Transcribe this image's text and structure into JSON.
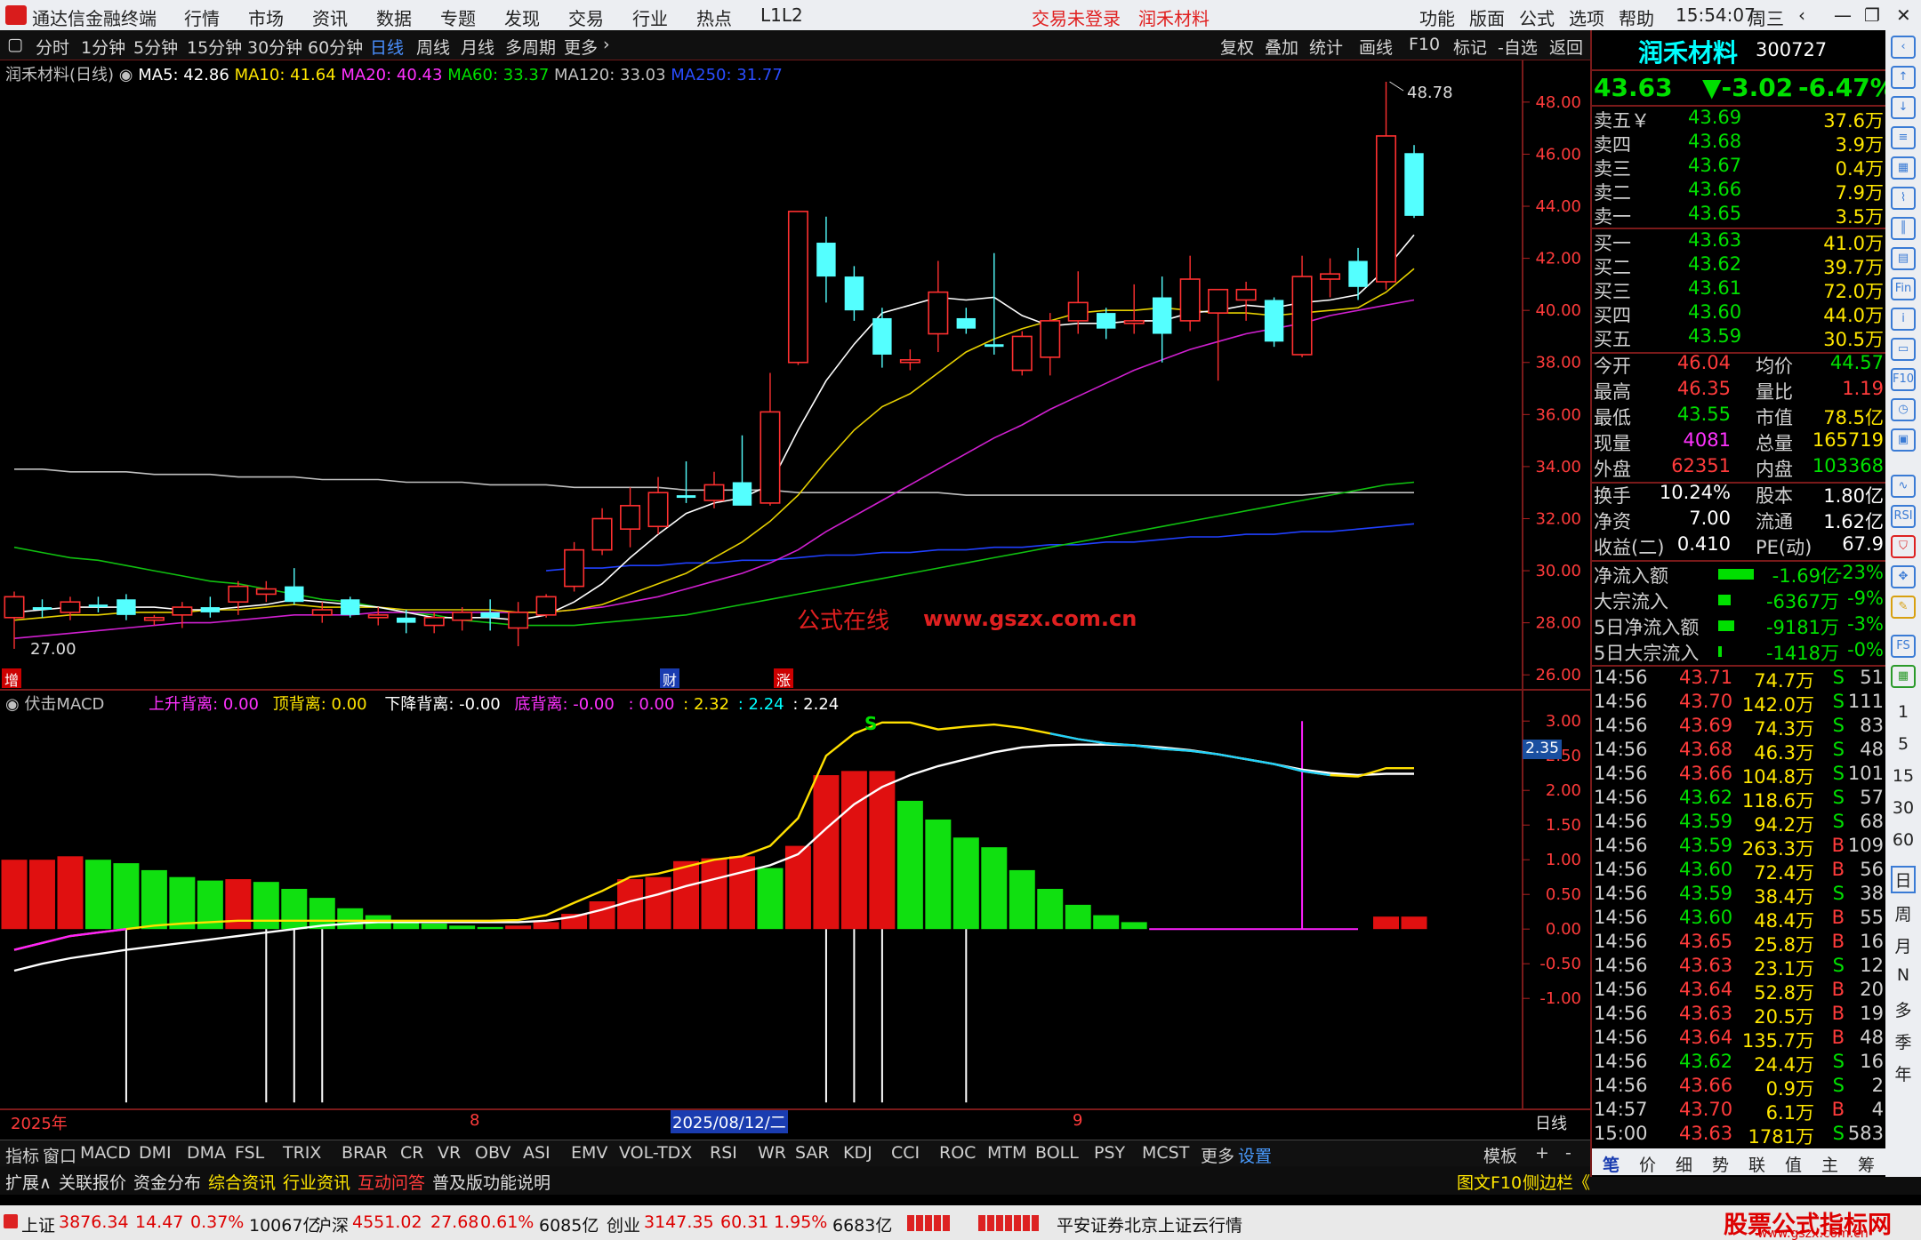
{
  "app": {
    "title": "通达信金融终端"
  },
  "menu": [
    "行情",
    "市场",
    "资讯",
    "数据",
    "专题",
    "发现",
    "交易",
    "行业",
    "热点",
    "L1L2"
  ],
  "notice": {
    "trade": "交易未登录",
    "stock": "润禾材料"
  },
  "window_menu": [
    "功能",
    "版面",
    "公式",
    "选项",
    "帮助"
  ],
  "clock": {
    "time": "15:54:07",
    "weekday": "周三"
  },
  "periods": [
    "分时",
    "1分钟",
    "5分钟",
    "15分钟",
    "30分钟",
    "60分钟",
    "日线",
    "周线",
    "月线",
    "多周期",
    "更多"
  ],
  "active_period": "日线",
  "chart_tools": [
    "复权",
    "叠加",
    "统计",
    "画线",
    "F10",
    "标记",
    "-自选",
    "返回"
  ],
  "ma_line": {
    "name": "润禾材料(日线)",
    "ma5": "MA5: 42.86",
    "ma10": "MA10: 41.64",
    "ma20": "MA20: 40.43",
    "ma60": "MA60: 33.37",
    "ma120": "MA120: 33.03",
    "ma250": "MA250: 31.77"
  },
  "price_axis": [
    "48.00",
    "46.00",
    "44.00",
    "42.00",
    "40.00",
    "38.00",
    "36.00",
    "34.00",
    "32.00",
    "30.00",
    "28.00",
    "26.00"
  ],
  "price_labels": {
    "high": "48.78",
    "low": "27.00"
  },
  "watermark": {
    "cn": "公式在线",
    "url": "www.gszx.com.cn"
  },
  "markers": {
    "zeng": "增",
    "cai": "财",
    "zhang": "涨"
  },
  "macd_header": {
    "name": "伏击MACD",
    "up_div": "上升背离: 0.00",
    "top_div": "顶背离: 0.00",
    "down_div": "下降背离: -0.00",
    "bottom_div": "底背离: -0.00",
    "v1": ": 0.00",
    "v2": ": 2.32",
    "v3": ": 2.24",
    "v4": ": 2.24"
  },
  "macd_axis": [
    "3.00",
    "2.50",
    "2.00",
    "1.50",
    "1.00",
    "0.50",
    "0.00",
    "-0.50",
    "-1.00"
  ],
  "macd_current": "2.35",
  "macd_s_label": "S",
  "date_axis": {
    "year": "2025年",
    "m8": "8",
    "cursor": "2025/08/12/二",
    "m9": "9",
    "period": "日线"
  },
  "chart_data": {
    "type": "candlestick",
    "ylim": [
      26,
      49
    ],
    "candles": [
      {
        "o": 28.2,
        "h": 29.2,
        "l": 27.0,
        "c": 29.0,
        "up": true
      },
      {
        "o": 28.6,
        "h": 28.9,
        "l": 28.2,
        "c": 28.5,
        "up": false
      },
      {
        "o": 28.4,
        "h": 29.0,
        "l": 28.1,
        "c": 28.8,
        "up": true
      },
      {
        "o": 28.7,
        "h": 29.0,
        "l": 28.4,
        "c": 28.6,
        "up": false
      },
      {
        "o": 28.9,
        "h": 29.1,
        "l": 28.1,
        "c": 28.3,
        "up": false
      },
      {
        "o": 28.1,
        "h": 28.3,
        "l": 27.9,
        "c": 28.2,
        "up": true
      },
      {
        "o": 28.3,
        "h": 28.8,
        "l": 27.8,
        "c": 28.6,
        "up": true
      },
      {
        "o": 28.6,
        "h": 29.0,
        "l": 28.2,
        "c": 28.4,
        "up": false
      },
      {
        "o": 28.8,
        "h": 29.6,
        "l": 28.3,
        "c": 29.4,
        "up": true
      },
      {
        "o": 29.1,
        "h": 29.6,
        "l": 28.8,
        "c": 29.3,
        "up": true
      },
      {
        "o": 29.4,
        "h": 30.1,
        "l": 28.7,
        "c": 28.8,
        "up": false
      },
      {
        "o": 28.5,
        "h": 28.8,
        "l": 28.0,
        "c": 28.3,
        "up": true
      },
      {
        "o": 28.9,
        "h": 29.0,
        "l": 28.2,
        "c": 28.3,
        "up": false
      },
      {
        "o": 28.2,
        "h": 28.6,
        "l": 27.9,
        "c": 28.3,
        "up": true
      },
      {
        "o": 28.2,
        "h": 28.5,
        "l": 27.6,
        "c": 28.0,
        "up": false
      },
      {
        "o": 27.9,
        "h": 28.4,
        "l": 27.6,
        "c": 28.2,
        "up": true
      },
      {
        "o": 28.1,
        "h": 28.6,
        "l": 27.7,
        "c": 28.4,
        "up": true
      },
      {
        "o": 28.4,
        "h": 28.9,
        "l": 27.7,
        "c": 28.2,
        "up": false
      },
      {
        "o": 28.4,
        "h": 28.8,
        "l": 27.1,
        "c": 27.8,
        "up": true
      },
      {
        "o": 28.3,
        "h": 29.1,
        "l": 28.2,
        "c": 29.0,
        "up": true
      },
      {
        "o": 29.4,
        "h": 31.1,
        "l": 29.2,
        "c": 30.8,
        "up": true
      },
      {
        "o": 30.8,
        "h": 32.4,
        "l": 30.6,
        "c": 32.0,
        "up": true
      },
      {
        "o": 31.6,
        "h": 33.2,
        "l": 30.9,
        "c": 32.5,
        "up": true
      },
      {
        "o": 31.7,
        "h": 33.6,
        "l": 31.4,
        "c": 33.0,
        "up": true
      },
      {
        "o": 32.9,
        "h": 34.2,
        "l": 32.6,
        "c": 32.8,
        "up": false
      },
      {
        "o": 32.7,
        "h": 33.8,
        "l": 32.4,
        "c": 33.3,
        "up": true
      },
      {
        "o": 33.4,
        "h": 35.2,
        "l": 32.8,
        "c": 32.5,
        "up": false
      },
      {
        "o": 32.6,
        "h": 37.6,
        "l": 32.5,
        "c": 36.1,
        "up": true
      },
      {
        "o": 38.0,
        "h": 43.8,
        "l": 37.9,
        "c": 43.8,
        "up": true
      },
      {
        "o": 42.6,
        "h": 43.6,
        "l": 40.3,
        "c": 41.3,
        "up": false
      },
      {
        "o": 41.3,
        "h": 41.7,
        "l": 39.6,
        "c": 40.0,
        "up": false
      },
      {
        "o": 39.7,
        "h": 40.1,
        "l": 37.8,
        "c": 38.3,
        "up": false
      },
      {
        "o": 38.0,
        "h": 38.5,
        "l": 37.7,
        "c": 38.1,
        "up": true
      },
      {
        "o": 39.1,
        "h": 41.9,
        "l": 38.4,
        "c": 40.7,
        "up": true
      },
      {
        "o": 39.7,
        "h": 40.1,
        "l": 39.1,
        "c": 39.3,
        "up": false
      },
      {
        "o": 38.7,
        "h": 42.2,
        "l": 38.3,
        "c": 38.6,
        "up": false
      },
      {
        "o": 37.7,
        "h": 39.2,
        "l": 37.5,
        "c": 39.0,
        "up": true
      },
      {
        "o": 38.2,
        "h": 39.9,
        "l": 37.5,
        "c": 39.6,
        "up": true
      },
      {
        "o": 39.6,
        "h": 41.5,
        "l": 39.1,
        "c": 40.3,
        "up": true
      },
      {
        "o": 39.9,
        "h": 40.1,
        "l": 38.9,
        "c": 39.3,
        "up": false
      },
      {
        "o": 39.5,
        "h": 41.0,
        "l": 39.1,
        "c": 39.6,
        "up": true
      },
      {
        "o": 40.5,
        "h": 41.3,
        "l": 38.0,
        "c": 39.1,
        "up": false
      },
      {
        "o": 39.6,
        "h": 42.1,
        "l": 39.2,
        "c": 41.2,
        "up": true
      },
      {
        "o": 39.9,
        "h": 40.7,
        "l": 37.3,
        "c": 40.8,
        "up": true
      },
      {
        "o": 40.8,
        "h": 41.1,
        "l": 39.6,
        "c": 40.4,
        "up": true
      },
      {
        "o": 40.4,
        "h": 40.5,
        "l": 38.6,
        "c": 38.8,
        "up": false
      },
      {
        "o": 38.3,
        "h": 42.1,
        "l": 38.2,
        "c": 41.3,
        "up": true
      },
      {
        "o": 41.2,
        "h": 42.0,
        "l": 40.5,
        "c": 41.4,
        "up": true
      },
      {
        "o": 41.9,
        "h": 42.4,
        "l": 40.4,
        "c": 40.9,
        "up": false
      },
      {
        "o": 41.1,
        "h": 48.78,
        "l": 40.8,
        "c": 46.7,
        "up": true
      },
      {
        "o": 46.04,
        "h": 46.35,
        "l": 43.55,
        "c": 43.63,
        "up": false
      }
    ],
    "ma5": [
      28.4,
      28.5,
      28.6,
      28.6,
      28.6,
      28.6,
      28.5,
      28.5,
      28.6,
      28.7,
      28.9,
      28.8,
      28.7,
      28.6,
      28.4,
      28.2,
      28.2,
      28.2,
      28.1,
      28.3,
      28.8,
      29.5,
      30.5,
      31.4,
      32.2,
      32.6,
      32.8,
      33.3,
      35.4,
      37.3,
      38.7,
      39.9,
      40.2,
      40.5,
      40.4,
      40.5,
      39.8,
      39.4,
      39.5,
      39.5,
      39.6,
      39.6,
      39.9,
      40.0,
      40.2,
      40.1,
      40.3,
      40.4,
      40.6,
      41.6,
      42.9
    ],
    "ma10": [
      28.1,
      28.2,
      28.3,
      28.3,
      28.4,
      28.4,
      28.4,
      28.5,
      28.5,
      28.6,
      28.7,
      28.6,
      28.6,
      28.6,
      28.5,
      28.5,
      28.5,
      28.5,
      28.4,
      28.4,
      28.5,
      28.7,
      29.1,
      29.5,
      29.9,
      30.5,
      31.1,
      31.9,
      32.9,
      34.2,
      35.4,
      36.3,
      36.8,
      37.6,
      38.4,
      38.9,
      39.3,
      39.6,
      39.9,
      40.0,
      40.0,
      40.1,
      40.0,
      39.9,
      39.9,
      39.8,
      39.9,
      40.0,
      40.1,
      40.7,
      41.6
    ],
    "ma20": [
      27.4,
      27.5,
      27.6,
      27.7,
      27.8,
      27.9,
      28.0,
      28.0,
      28.1,
      28.2,
      28.3,
      28.3,
      28.3,
      28.4,
      28.4,
      28.4,
      28.4,
      28.4,
      28.4,
      28.4,
      28.5,
      28.6,
      28.8,
      29.0,
      29.3,
      29.6,
      29.9,
      30.3,
      30.8,
      31.5,
      32.1,
      32.7,
      33.3,
      33.9,
      34.5,
      35.1,
      35.6,
      36.2,
      36.7,
      37.2,
      37.7,
      38.1,
      38.5,
      38.8,
      39.1,
      39.3,
      39.5,
      39.8,
      40.0,
      40.2,
      40.4
    ],
    "ma60": [
      30.9,
      30.7,
      30.5,
      30.4,
      30.2,
      30.0,
      29.8,
      29.6,
      29.5,
      29.3,
      29.1,
      28.9,
      28.8,
      28.6,
      28.4,
      28.3,
      28.1,
      28.0,
      27.9,
      27.9,
      27.9,
      28.0,
      28.1,
      28.2,
      28.3,
      28.5,
      28.7,
      28.9,
      29.1,
      29.3,
      29.5,
      29.7,
      29.9,
      30.1,
      30.3,
      30.5,
      30.7,
      30.9,
      31.1,
      31.3,
      31.5,
      31.7,
      31.9,
      32.1,
      32.3,
      32.5,
      32.7,
      32.9,
      33.1,
      33.3,
      33.4
    ],
    "ma120": [
      33.9,
      33.9,
      33.8,
      33.8,
      33.8,
      33.7,
      33.7,
      33.7,
      33.6,
      33.6,
      33.6,
      33.5,
      33.5,
      33.5,
      33.4,
      33.4,
      33.4,
      33.3,
      33.3,
      33.3,
      33.2,
      33.2,
      33.2,
      33.2,
      33.1,
      33.1,
      33.1,
      33.1,
      33.0,
      33.0,
      33.0,
      33.0,
      33.0,
      33.0,
      32.9,
      32.9,
      32.9,
      32.9,
      32.9,
      32.9,
      32.9,
      32.9,
      32.9,
      32.9,
      32.9,
      32.9,
      32.9,
      33.0,
      33.0,
      33.0,
      33.0
    ],
    "ma250": [
      null,
      null,
      null,
      null,
      null,
      null,
      null,
      null,
      null,
      null,
      null,
      null,
      null,
      null,
      null,
      null,
      null,
      null,
      null,
      30.0,
      30.1,
      30.1,
      30.2,
      30.2,
      30.3,
      30.3,
      30.4,
      30.4,
      30.5,
      30.6,
      30.6,
      30.7,
      30.7,
      30.8,
      30.8,
      30.9,
      30.9,
      31.0,
      31.0,
      31.1,
      31.1,
      31.2,
      31.3,
      31.3,
      31.4,
      31.4,
      31.5,
      31.5,
      31.6,
      31.7,
      31.8
    ],
    "macd": {
      "ylim": [
        -1.5,
        3.2
      ],
      "bars": [
        1.0,
        1.0,
        1.05,
        1.0,
        0.95,
        0.85,
        0.75,
        0.7,
        0.72,
        0.68,
        0.58,
        0.45,
        0.3,
        0.2,
        0.12,
        0.08,
        0.05,
        0.03,
        0.05,
        0.1,
        0.22,
        0.4,
        0.72,
        0.75,
        0.98,
        1.02,
        1.05,
        0.88,
        1.2,
        2.22,
        2.28,
        2.28,
        1.85,
        1.58,
        1.32,
        1.18,
        0.85,
        0.58,
        0.35,
        0.2,
        0.1,
        0.0,
        0.0,
        0.0,
        0.0,
        0.0,
        0.0,
        0.0,
        0.0,
        0.18,
        0.18
      ],
      "dif": [
        -0.3,
        -0.2,
        -0.1,
        -0.05,
        0.0,
        0.05,
        0.08,
        0.1,
        0.12,
        0.12,
        0.12,
        0.12,
        0.12,
        0.12,
        0.12,
        0.12,
        0.12,
        0.12,
        0.13,
        0.2,
        0.38,
        0.55,
        0.75,
        0.8,
        0.9,
        1.0,
        1.05,
        1.2,
        1.6,
        2.5,
        2.82,
        2.98,
        2.98,
        2.88,
        2.92,
        2.95,
        2.9,
        2.82,
        2.74,
        2.68,
        2.65,
        2.6,
        2.57,
        2.52,
        2.45,
        2.38,
        2.28,
        2.22,
        2.2,
        2.32,
        2.32
      ],
      "dea": [
        -0.6,
        -0.5,
        -0.42,
        -0.36,
        -0.3,
        -0.25,
        -0.2,
        -0.15,
        -0.1,
        -0.05,
        0.0,
        0.05,
        0.08,
        0.1,
        0.1,
        0.1,
        0.1,
        0.1,
        0.1,
        0.12,
        0.18,
        0.28,
        0.4,
        0.5,
        0.62,
        0.72,
        0.82,
        0.92,
        1.08,
        1.45,
        1.8,
        2.05,
        2.22,
        2.35,
        2.45,
        2.55,
        2.62,
        2.65,
        2.66,
        2.66,
        2.65,
        2.62,
        2.58,
        2.52,
        2.45,
        2.38,
        2.3,
        2.25,
        2.22,
        2.24,
        2.24
      ]
    }
  },
  "quote": {
    "name": "润禾材料",
    "code": "300727",
    "price": "43.63",
    "change": "▼-3.02",
    "pct": "-6.47%",
    "asks": [
      [
        "卖五￥",
        "43.69",
        "37.6万"
      ],
      [
        "卖四",
        "43.68",
        "3.9万"
      ],
      [
        "卖三",
        "43.67",
        "0.4万"
      ],
      [
        "卖二",
        "43.66",
        "7.9万"
      ],
      [
        "卖一",
        "43.65",
        "3.5万"
      ]
    ],
    "bids": [
      [
        "买一",
        "43.63",
        "41.0万"
      ],
      [
        "买二",
        "43.62",
        "39.7万"
      ],
      [
        "买三",
        "43.61",
        "72.0万"
      ],
      [
        "买四",
        "43.60",
        "44.0万"
      ],
      [
        "买五",
        "43.59",
        "30.5万"
      ]
    ],
    "stats1": [
      [
        "今开",
        "46.04",
        "均价",
        "44.57"
      ],
      [
        "最高",
        "46.35",
        "量比",
        "1.19"
      ],
      [
        "最低",
        "43.55",
        "市值",
        "78.5亿"
      ],
      [
        "现量",
        "4081",
        "总量",
        "165719"
      ],
      [
        "外盘",
        "62351",
        "内盘",
        "103368"
      ]
    ],
    "stats2": [
      [
        "换手",
        "10.24%",
        "股本",
        "1.80亿"
      ],
      [
        "净资",
        "7.00",
        "流通",
        "1.62亿"
      ],
      [
        "收益(二)",
        "0.410",
        "PE(动)",
        "67.9"
      ]
    ],
    "flows": [
      [
        "净流入额",
        "-1.69亿",
        "-23%"
      ],
      [
        "大宗流入",
        "-6367万",
        "-9%"
      ],
      [
        "5日净流入额",
        "-9181万",
        "-3%"
      ],
      [
        "5日大宗流入",
        "-1418万",
        "-0%"
      ]
    ],
    "ticks": [
      [
        "14:56",
        "43.71",
        "74.7万",
        "S",
        "51"
      ],
      [
        "14:56",
        "43.70",
        "142.0万",
        "S",
        "111"
      ],
      [
        "14:56",
        "43.69",
        "74.3万",
        "S",
        "83"
      ],
      [
        "14:56",
        "43.68",
        "46.3万",
        "S",
        "48"
      ],
      [
        "14:56",
        "43.66",
        "104.8万",
        "S",
        "101"
      ],
      [
        "14:56",
        "43.62",
        "118.6万",
        "S",
        "57"
      ],
      [
        "14:56",
        "43.59",
        "94.2万",
        "S",
        "68"
      ],
      [
        "14:56",
        "43.59",
        "263.3万",
        "B",
        "109"
      ],
      [
        "14:56",
        "43.60",
        "72.4万",
        "B",
        "56"
      ],
      [
        "14:56",
        "43.59",
        "38.4万",
        "S",
        "38"
      ],
      [
        "14:56",
        "43.60",
        "48.4万",
        "B",
        "55"
      ],
      [
        "14:56",
        "43.65",
        "25.8万",
        "B",
        "16"
      ],
      [
        "14:56",
        "43.63",
        "23.1万",
        "S",
        "12"
      ],
      [
        "14:56",
        "43.64",
        "52.8万",
        "B",
        "20"
      ],
      [
        "14:56",
        "43.63",
        "20.5万",
        "B",
        "19"
      ],
      [
        "14:56",
        "43.64",
        "135.7万",
        "B",
        "48"
      ],
      [
        "14:56",
        "43.62",
        "24.4万",
        "S",
        "16"
      ],
      [
        "14:56",
        "43.66",
        "0.9万",
        "S",
        "2"
      ],
      [
        "14:57",
        "43.70",
        "6.1万",
        "B",
        "4"
      ],
      [
        "15:00",
        "43.63",
        "1781万",
        "S",
        "583"
      ]
    ],
    "tabs": [
      "笔",
      "价",
      "细",
      "势",
      "联",
      "值",
      "主",
      "筹"
    ]
  },
  "indicators": [
    "指标",
    "窗口",
    "MACD",
    "DMI",
    "DMA",
    "FSL",
    "TRIX",
    "BRAR",
    "CR",
    "VR",
    "OBV",
    "ASI",
    "EMV",
    "VOL-TDX",
    "RSI",
    "WR",
    "SAR",
    "KDJ",
    "CCI",
    "ROC",
    "MTM",
    "BOLL",
    "PSY",
    "MCST",
    "更多",
    "设置"
  ],
  "indicator_right": {
    "template": "模板",
    "plus": "+",
    "minus": "-"
  },
  "info_tabs": [
    "扩展∧",
    "关联报价",
    "资金分布",
    "综合资讯",
    "行业资讯",
    "互动问答",
    "普及版功能说明"
  ],
  "info_right": {
    "f10": "图文F10",
    "side": "侧边栏《"
  },
  "sidebar_text": [
    "1",
    "5",
    "15",
    "30",
    "60",
    "日",
    "周",
    "月",
    "N",
    "多",
    "季",
    "年"
  ],
  "status": {
    "sh": [
      "上证",
      "3876.34",
      "14.47",
      "0.37%",
      "10067亿"
    ],
    "hs": [
      "沪深",
      "4551.02",
      "27.68",
      "0.61%",
      "6085亿"
    ],
    "cy": [
      "创业",
      "3147.35",
      "60.31",
      "1.95%",
      "6683亿"
    ],
    "broker": "平安证券北京上证云行情",
    "brand": "股票公式指标网",
    "brand_url": "www.gszx.com.cn"
  }
}
